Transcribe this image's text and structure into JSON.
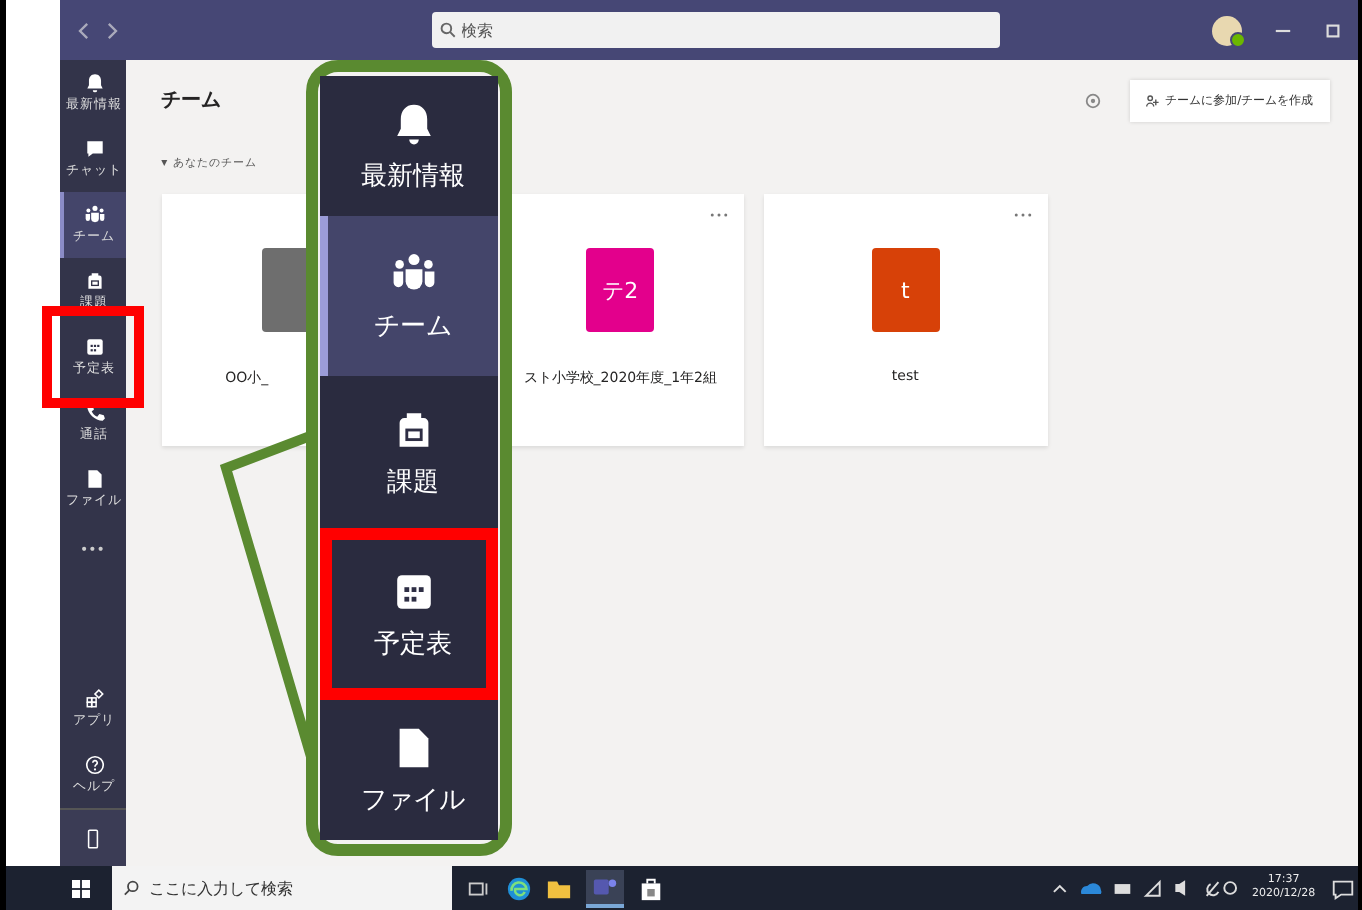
{
  "title_bar": {
    "search_placeholder": "検索"
  },
  "rail": {
    "items": [
      {
        "kind": "bell",
        "label": "最新情報",
        "selected": false,
        "highlighted": false
      },
      {
        "kind": "chat",
        "label": "チャット",
        "selected": false,
        "highlighted": false
      },
      {
        "kind": "team",
        "label": "チーム",
        "selected": true,
        "highlighted": false
      },
      {
        "kind": "bag",
        "label": "課題",
        "selected": false,
        "highlighted": false
      },
      {
        "kind": "calendar",
        "label": "予定表",
        "selected": false,
        "highlighted": true
      },
      {
        "kind": "phone",
        "label": "通話",
        "selected": false,
        "highlighted": false
      },
      {
        "kind": "file",
        "label": "ファイル",
        "selected": false,
        "highlighted": false
      }
    ],
    "more": "•••",
    "bottom_items": [
      {
        "kind": "apps",
        "label": "アプリ"
      },
      {
        "kind": "help",
        "label": "ヘルプ"
      }
    ]
  },
  "header": {
    "title": "チーム",
    "join_button": "チームに参加/チームを作成"
  },
  "section": {
    "caret": "▾",
    "label": "あなたのチーム"
  },
  "teams": [
    {
      "name": "OO小_",
      "color": "#6e6e6e"
    },
    {
      "avatar_text": "テ2",
      "name": "スト小学校_2020年度_1年2組",
      "color": "#e3008c"
    },
    {
      "avatar_text": "t",
      "name": "test",
      "color": "#d74108"
    }
  ],
  "callout": {
    "items": [
      {
        "kind": "bell",
        "label": "最新情報",
        "selected": false,
        "highlighted": false
      },
      {
        "kind": "team",
        "label": "チーム",
        "selected": true,
        "highlighted": false
      },
      {
        "kind": "bag",
        "label": "課題",
        "selected": false,
        "highlighted": false
      },
      {
        "kind": "calendar",
        "label": "予定表",
        "selected": false,
        "highlighted": true
      },
      {
        "kind": "file",
        "label": "ファイル",
        "selected": false,
        "highlighted": false
      }
    ]
  },
  "taskbar": {
    "search_placeholder": "ここに入力して検索",
    "time": "17:37",
    "date": "2020/12/28"
  }
}
